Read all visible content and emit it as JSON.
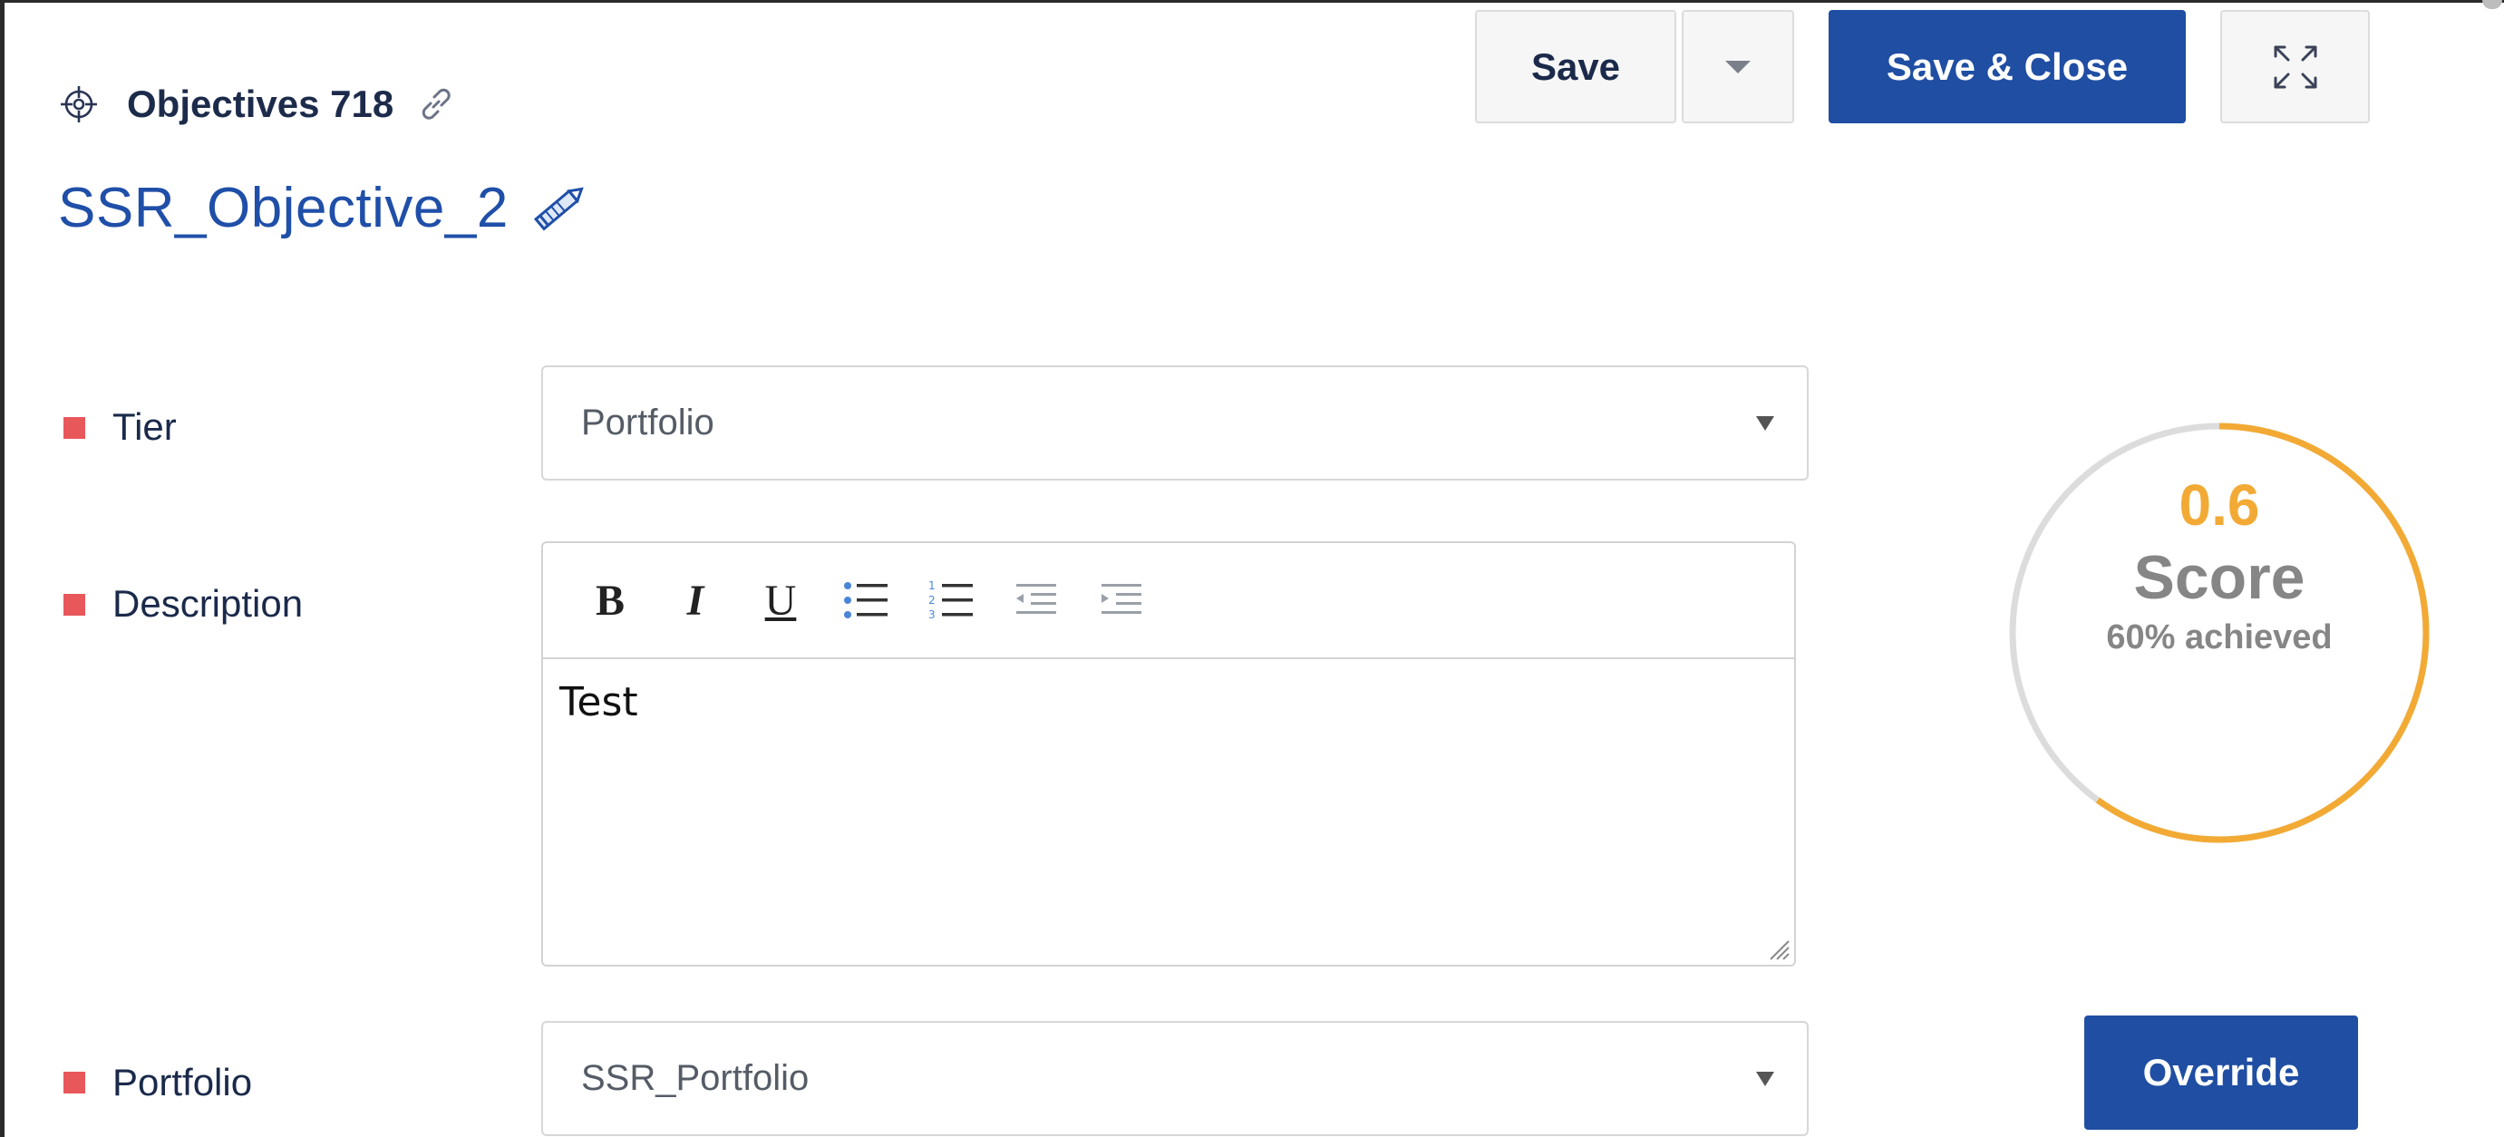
{
  "header": {
    "breadcrumb_label": "Objectives 718",
    "title": "SSR_Objective_2"
  },
  "toolbar": {
    "save_label": "Save",
    "save_close_label": "Save & Close"
  },
  "form": {
    "tier": {
      "label": "Tier",
      "value": "Portfolio"
    },
    "description": {
      "label": "Description",
      "value": "Test"
    },
    "portfolio": {
      "label": "Portfolio",
      "value": "SSR_Portfolio"
    }
  },
  "score": {
    "value": "0.6",
    "label": "Score",
    "achieved_text": "60% achieved",
    "fraction": 0.6,
    "color": "#f2aa35"
  },
  "override_label": "Override",
  "colors": {
    "primary": "#1f4ea3",
    "required_marker": "#e8575a",
    "title": "#1f4fa8"
  },
  "icons": [
    "target-icon",
    "link-icon",
    "pencil-icon",
    "chevron-down-icon",
    "expand-icon",
    "bold-icon",
    "italic-icon",
    "underline-icon",
    "bulleted-list-icon",
    "numbered-list-icon",
    "outdent-icon",
    "indent-icon"
  ]
}
